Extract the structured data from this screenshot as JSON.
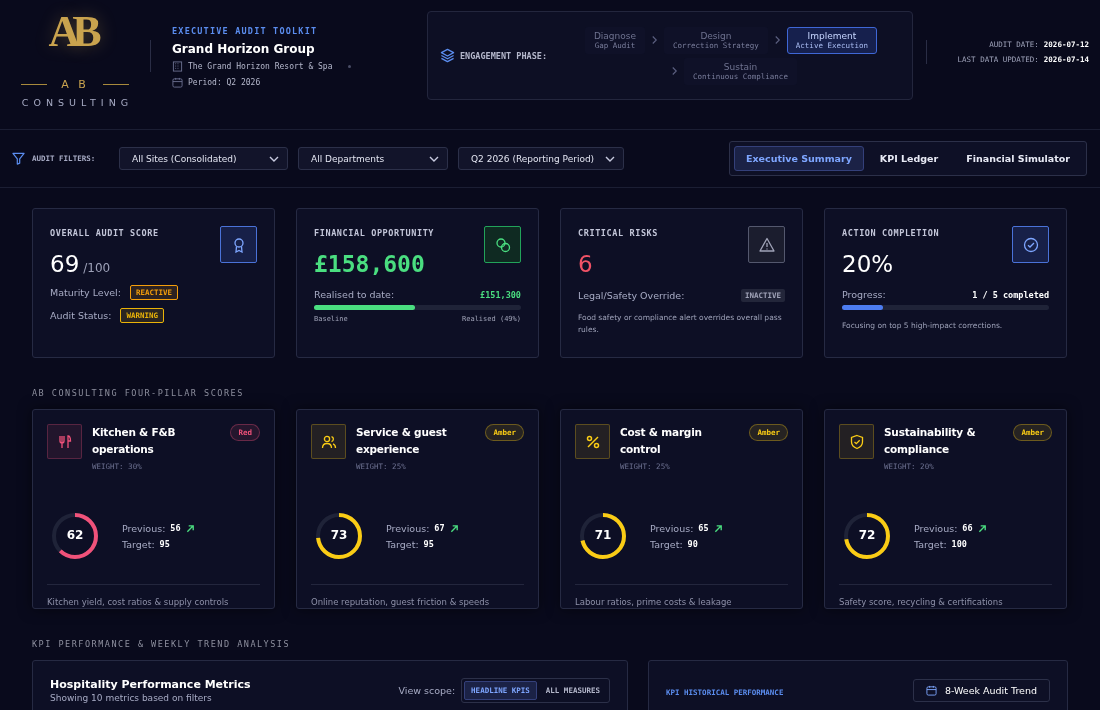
{
  "brand": {
    "mark": "AB",
    "letters": "A B",
    "name": "CONSULTING"
  },
  "header": {
    "eyebrow": "EXECUTIVE AUDIT TOOLKIT",
    "client": "Grand Horizon Group",
    "site": "The Grand Horizon Resort & Spa",
    "period": "Period: Q2 2026"
  },
  "engagement": {
    "label": "ENGAGEMENT PHASE:",
    "phases": [
      {
        "name": "Diagnose",
        "sub": "Gap Audit",
        "selected": false
      },
      {
        "name": "Design",
        "sub": "Correction Strategy",
        "selected": false
      },
      {
        "name": "Implement",
        "sub": "Active Execution",
        "selected": true
      },
      {
        "name": "Sustain",
        "sub": "Continuous Compliance",
        "selected": false
      }
    ]
  },
  "dates": [
    {
      "label": "AUDIT DATE:",
      "value": "2026-07-12"
    },
    {
      "label": "LAST DATA UPDATED:",
      "value": "2026-07-14"
    }
  ],
  "filters": {
    "label": "AUDIT FILTERS:",
    "selects": [
      "All Sites (Consolidated)",
      "All Departments",
      "Q2 2026 (Reporting Period)"
    ]
  },
  "views": [
    {
      "label": "Executive Summary",
      "selected": true
    },
    {
      "label": "KPI Ledger",
      "selected": false
    },
    {
      "label": "Financial Simulator",
      "selected": false
    }
  ],
  "kpis": [
    {
      "kind": "score",
      "title": "OVERALL AUDIT SCORE",
      "value": "69",
      "unit": "/100",
      "rows": [
        {
          "label": "Maturity Level:",
          "badge": "REACTIVE",
          "color": "#f59e0b"
        },
        {
          "label": "Audit Status:",
          "badge": "WARNING",
          "color": "#eab308"
        }
      ]
    },
    {
      "kind": "financial",
      "title": "FINANCIAL OPPORTUNITY",
      "value": "£158,600",
      "progress_label": "Realised to date:",
      "progress_value": "£151,300",
      "level": 0.49,
      "start": "Baseline",
      "end": "Realised (49%)"
    },
    {
      "kind": "risk",
      "title": "CRITICAL RISKS",
      "value": "6",
      "override_label": "Legal/Safety Override:",
      "override_state": "INACTIVE",
      "note": "Food safety or compliance alert overrides overall pass rules."
    },
    {
      "kind": "completion",
      "title": "ACTION COMPLETION",
      "value": "20%",
      "progress_label": "Progress:",
      "progress_value": "1 / 5 completed",
      "level": 0.2,
      "note": "Focusing on top 5 high-impact corrections."
    }
  ],
  "pillars_title": "AB CONSULTING FOUR-PILLAR SCORES",
  "pillars": [
    {
      "name": "Kitchen & F&B operations",
      "weight": "WEIGHT: 30%",
      "status": "Red",
      "color": "#f0527a",
      "score": "62",
      "level": 0.62,
      "previous_label": "Previous:",
      "previous": "56",
      "target_label": "Target:",
      "target": "95",
      "description": "Kitchen yield, cost ratios & supply controls"
    },
    {
      "name": "Service & guest experience",
      "weight": "WEIGHT: 25%",
      "status": "Amber",
      "color": "#facc15",
      "score": "73",
      "level": 0.73,
      "previous_label": "Previous:",
      "previous": "67",
      "target_label": "Target:",
      "target": "95",
      "description": "Online reputation, guest friction & speeds"
    },
    {
      "name": "Cost & margin control",
      "weight": "WEIGHT: 25%",
      "status": "Amber",
      "color": "#facc15",
      "score": "71",
      "level": 0.71,
      "previous_label": "Previous:",
      "previous": "65",
      "target_label": "Target:",
      "target": "90",
      "description": "Labour ratios, prime costs & leakage"
    },
    {
      "name": "Sustainability & compliance",
      "weight": "WEIGHT: 20%",
      "status": "Amber",
      "color": "#facc15",
      "score": "72",
      "level": 0.72,
      "previous_label": "Previous:",
      "previous": "66",
      "target_label": "Target:",
      "target": "100",
      "description": "Safety score, recycling & certifications"
    }
  ],
  "kpi_section": {
    "title": "KPI PERFORMANCE & WEEKLY TREND ANALYSIS",
    "metrics": {
      "title": "Hospitality Performance Metrics",
      "subtitle": "Showing 10 metrics based on filters",
      "scope_label": "View scope:",
      "scopes": [
        {
          "label": "HEADLINE KPIS",
          "selected": true
        },
        {
          "label": "ALL MEASURES",
          "selected": false
        }
      ]
    },
    "history": {
      "title": "KPI HISTORICAL PERFORMANCE",
      "button": "8-Week Audit Trend"
    }
  }
}
